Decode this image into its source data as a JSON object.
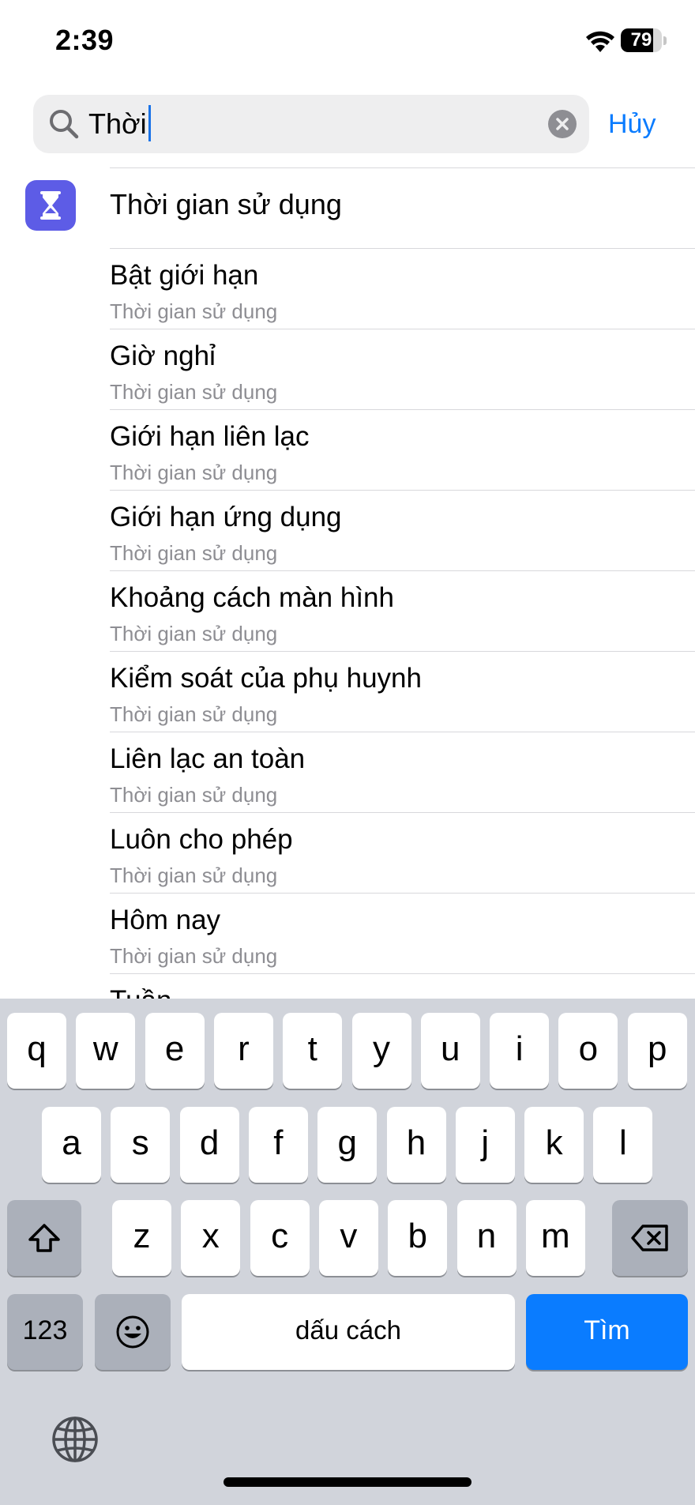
{
  "status_bar": {
    "time": "2:39",
    "battery_level": "79",
    "battery_fraction": 0.79
  },
  "search": {
    "value": "Thời",
    "cancel_label": "Hủy"
  },
  "results": {
    "app": {
      "title": "Thời gian sử dụng",
      "icon": "hourglass-icon",
      "icon_color": "#5d5ce6"
    },
    "items": [
      {
        "title": "Bật giới hạn",
        "subtitle": "Thời gian sử dụng"
      },
      {
        "title": "Giờ nghỉ",
        "subtitle": "Thời gian sử dụng"
      },
      {
        "title": "Giới hạn liên lạc",
        "subtitle": "Thời gian sử dụng"
      },
      {
        "title": "Giới hạn ứng dụng",
        "subtitle": "Thời gian sử dụng"
      },
      {
        "title": "Khoảng cách màn hình",
        "subtitle": "Thời gian sử dụng"
      },
      {
        "title": "Kiểm soát của phụ huynh",
        "subtitle": "Thời gian sử dụng"
      },
      {
        "title": "Liên lạc an toàn",
        "subtitle": "Thời gian sử dụng"
      },
      {
        "title": "Luôn cho phép",
        "subtitle": "Thời gian sử dụng"
      },
      {
        "title": "Hôm nay",
        "subtitle": "Thời gian sử dụng"
      },
      {
        "title": "Tuần",
        "subtitle": ""
      }
    ]
  },
  "keyboard": {
    "row1": [
      "q",
      "w",
      "e",
      "r",
      "t",
      "y",
      "u",
      "i",
      "o",
      "p"
    ],
    "row2": [
      "a",
      "s",
      "d",
      "f",
      "g",
      "h",
      "j",
      "k",
      "l"
    ],
    "row3": [
      "z",
      "x",
      "c",
      "v",
      "b",
      "n",
      "m"
    ],
    "numbers_label": "123",
    "space_label": "dấu cách",
    "go_label": "Tìm",
    "accent_color": "#0a7cff"
  }
}
